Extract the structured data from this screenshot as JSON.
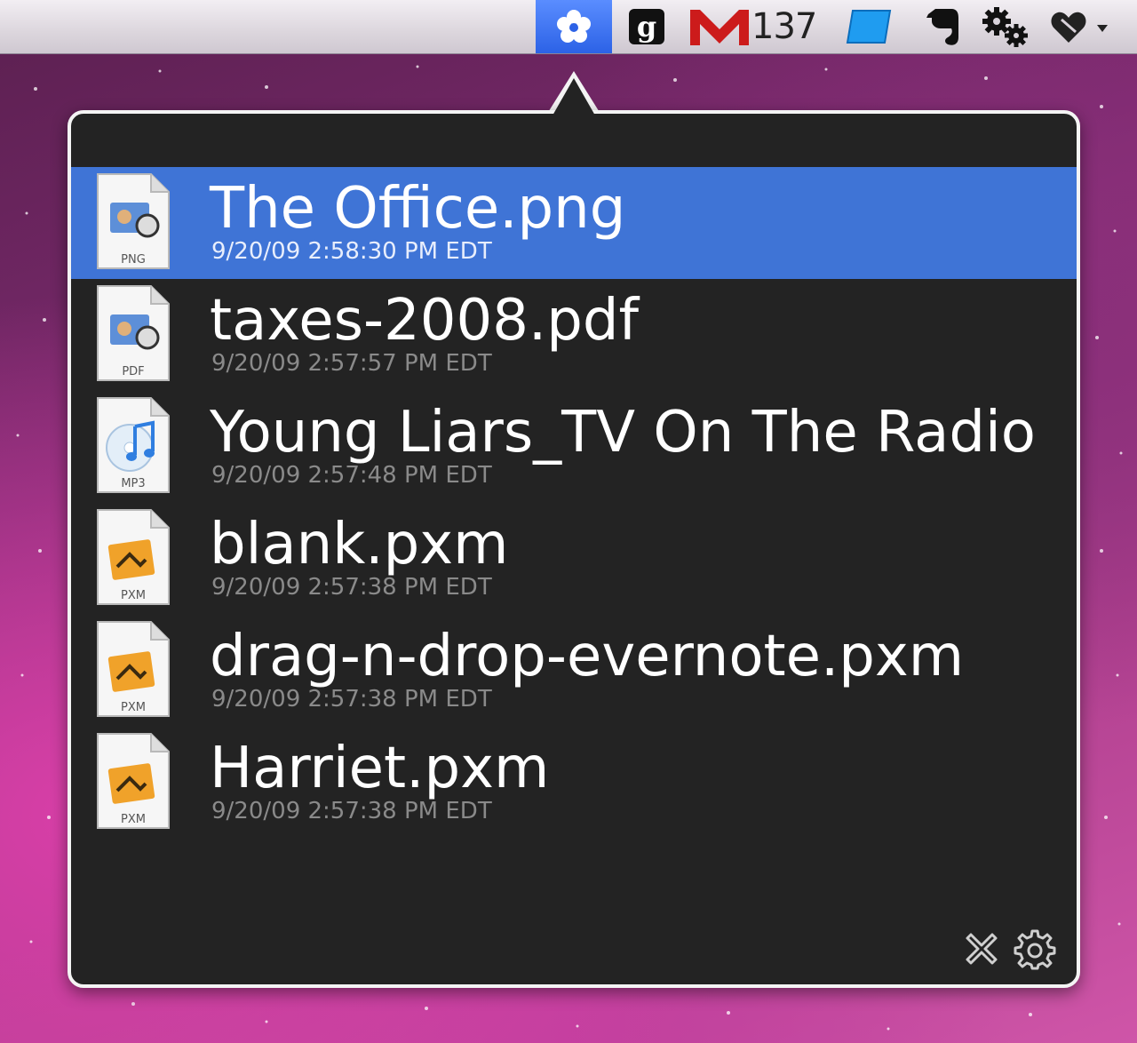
{
  "menubar": {
    "items": [
      {
        "name": "flower-icon",
        "active": true
      },
      {
        "name": "g-icon"
      },
      {
        "name": "gmail-icon",
        "count": "137"
      },
      {
        "name": "blue-square-icon"
      },
      {
        "name": "evernote-icon"
      },
      {
        "name": "gears-icon"
      },
      {
        "name": "heart-menu-icon"
      }
    ],
    "gmail_count": "137",
    "active_color": "#2c62e6"
  },
  "recent_files": [
    {
      "name": "The Office.png",
      "date": "9/20/09 2:58:30 PM EDT",
      "type": "PNG",
      "icon": "png-file-icon",
      "selected": true
    },
    {
      "name": "taxes-2008.pdf",
      "date": "9/20/09 2:57:57 PM EDT",
      "type": "PDF",
      "icon": "pdf-file-icon",
      "selected": false
    },
    {
      "name": "Young Liars_TV On The Radio",
      "date": "9/20/09 2:57:48 PM EDT",
      "type": "MP3",
      "icon": "mp3-file-icon",
      "selected": false
    },
    {
      "name": "blank.pxm",
      "date": "9/20/09 2:57:38 PM EDT",
      "type": "PXM",
      "icon": "pxm-file-icon",
      "selected": false
    },
    {
      "name": "drag-n-drop-evernote.pxm",
      "date": "9/20/09 2:57:38 PM EDT",
      "type": "PXM",
      "icon": "pxm-file-icon",
      "selected": false
    },
    {
      "name": "Harriet.pxm",
      "date": "9/20/09 2:57:38 PM EDT",
      "type": "PXM",
      "icon": "pxm-file-icon",
      "selected": false
    }
  ],
  "footer": {
    "close_icon": "close-icon",
    "settings_icon": "gear-icon"
  },
  "colors": {
    "selection": "#3f74d6",
    "panel_bg": "#232323"
  }
}
